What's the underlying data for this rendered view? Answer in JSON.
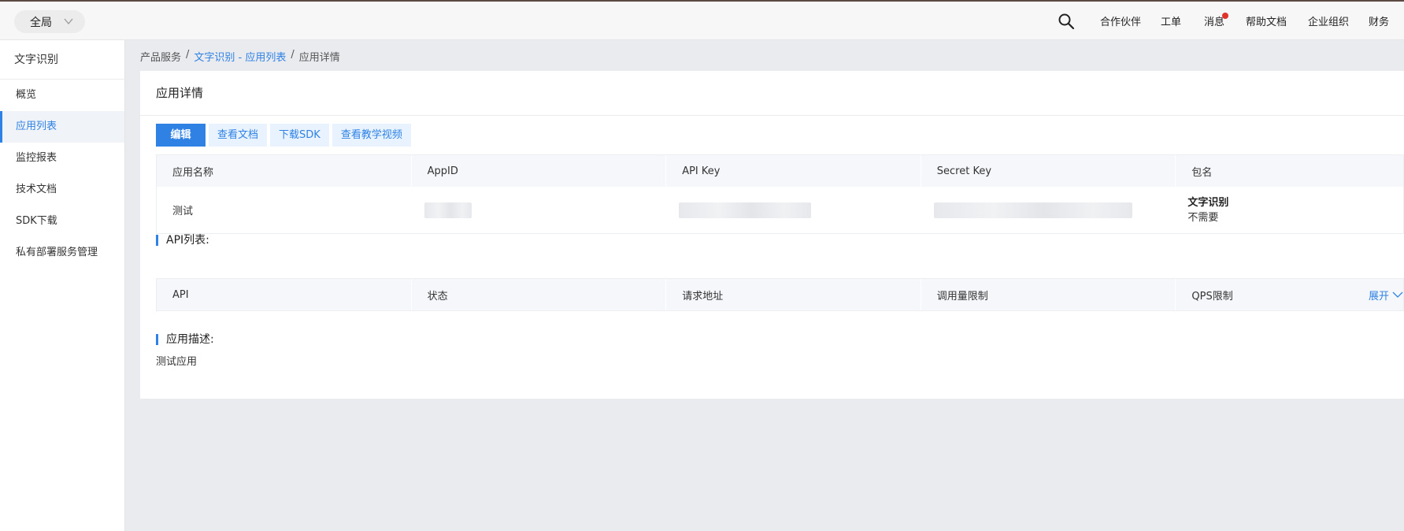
{
  "topbar": {
    "scope_label": "全局",
    "nav": [
      {
        "label": "合作伙伴"
      },
      {
        "label": "工单"
      },
      {
        "label": "消息"
      },
      {
        "label": "帮助文档"
      },
      {
        "label": "企业组织"
      },
      {
        "label": "财务"
      }
    ],
    "badge_color": "#e0332b"
  },
  "sidebar": {
    "product": "文字识别",
    "items": [
      {
        "label": "概览"
      },
      {
        "label": "应用列表"
      },
      {
        "label": "监控报表"
      },
      {
        "label": "技术文档"
      },
      {
        "label": "SDK下载"
      },
      {
        "label": "私有部署服务管理"
      }
    ],
    "active_index": 1
  },
  "breadcrumb": {
    "root": "产品服务",
    "sep": "/",
    "middle": "文字识别 - 应用列表",
    "current": "应用详情"
  },
  "card": {
    "title": "应用详情",
    "buttons": {
      "edit": "编辑",
      "docs": "查看文档",
      "sdk": "下载SDK",
      "video": "查看教学视频"
    },
    "app_table": {
      "headers": [
        "应用名称",
        "AppID",
        "API Key",
        "Secret Key",
        "包名"
      ],
      "row": {
        "name": "测试",
        "package_name": "文字识别",
        "package_value": "不需要"
      }
    },
    "api_section_title": "API列表:",
    "api_table": {
      "headers": [
        "API",
        "状态",
        "请求地址",
        "调用量限制",
        "QPS限制"
      ],
      "expand_label": "展开"
    },
    "desc_section_title": "应用描述:",
    "description": "测试应用"
  },
  "colors": {
    "accent": "#2f82e3",
    "page_bg": "#e9ebef",
    "table_header_bg": "#f5f7fa"
  }
}
